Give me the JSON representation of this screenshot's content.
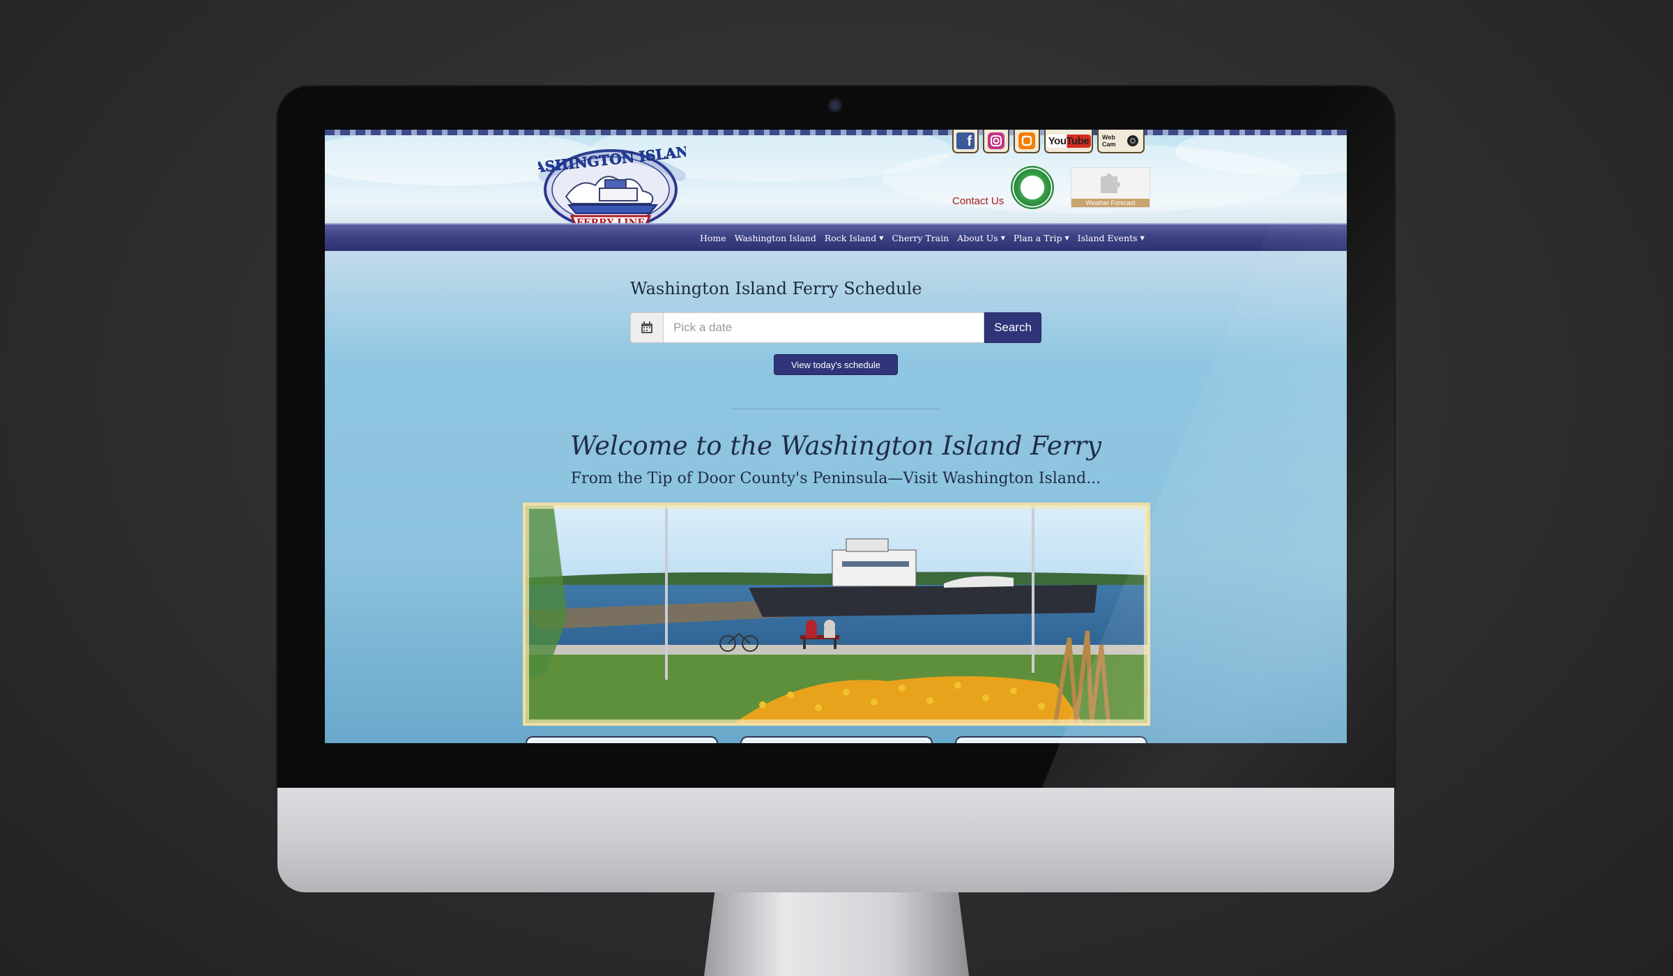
{
  "site": {
    "logo": {
      "text_top": "WASHINGTON ISLAND",
      "text_banner": "FERRY LINE"
    },
    "social": [
      {
        "icon": "facebook-icon",
        "label": "f"
      },
      {
        "icon": "instagram-icon",
        "label": ""
      },
      {
        "icon": "blogger-icon",
        "label": ""
      },
      {
        "icon": "youtube-icon",
        "label": "YouTube"
      },
      {
        "icon": "webcam-icon",
        "label": "Web Cam"
      }
    ],
    "contact_us": "Contact Us",
    "weather_label": "Weather Forecast",
    "nav": [
      {
        "label": "Home",
        "dropdown": false
      },
      {
        "label": "Washington Island",
        "dropdown": false
      },
      {
        "label": "Rock Island",
        "dropdown": true
      },
      {
        "label": "Cherry Train",
        "dropdown": false
      },
      {
        "label": "About Us",
        "dropdown": true
      },
      {
        "label": "Plan a Trip",
        "dropdown": true
      },
      {
        "label": "Island Events",
        "dropdown": true
      }
    ],
    "colors": {
      "nav_blue": "#2f3578",
      "contact_red": "#a11a1a"
    }
  },
  "schedule": {
    "title": "Washington Island Ferry Schedule",
    "date_placeholder": "Pick a date",
    "search_label": "Search",
    "today_label": "View today's schedule"
  },
  "welcome": {
    "title": "Welcome to the Washington Island Ferry",
    "subtitle": "From the Tip of Door County's Peninsula—Visit Washington Island..."
  }
}
